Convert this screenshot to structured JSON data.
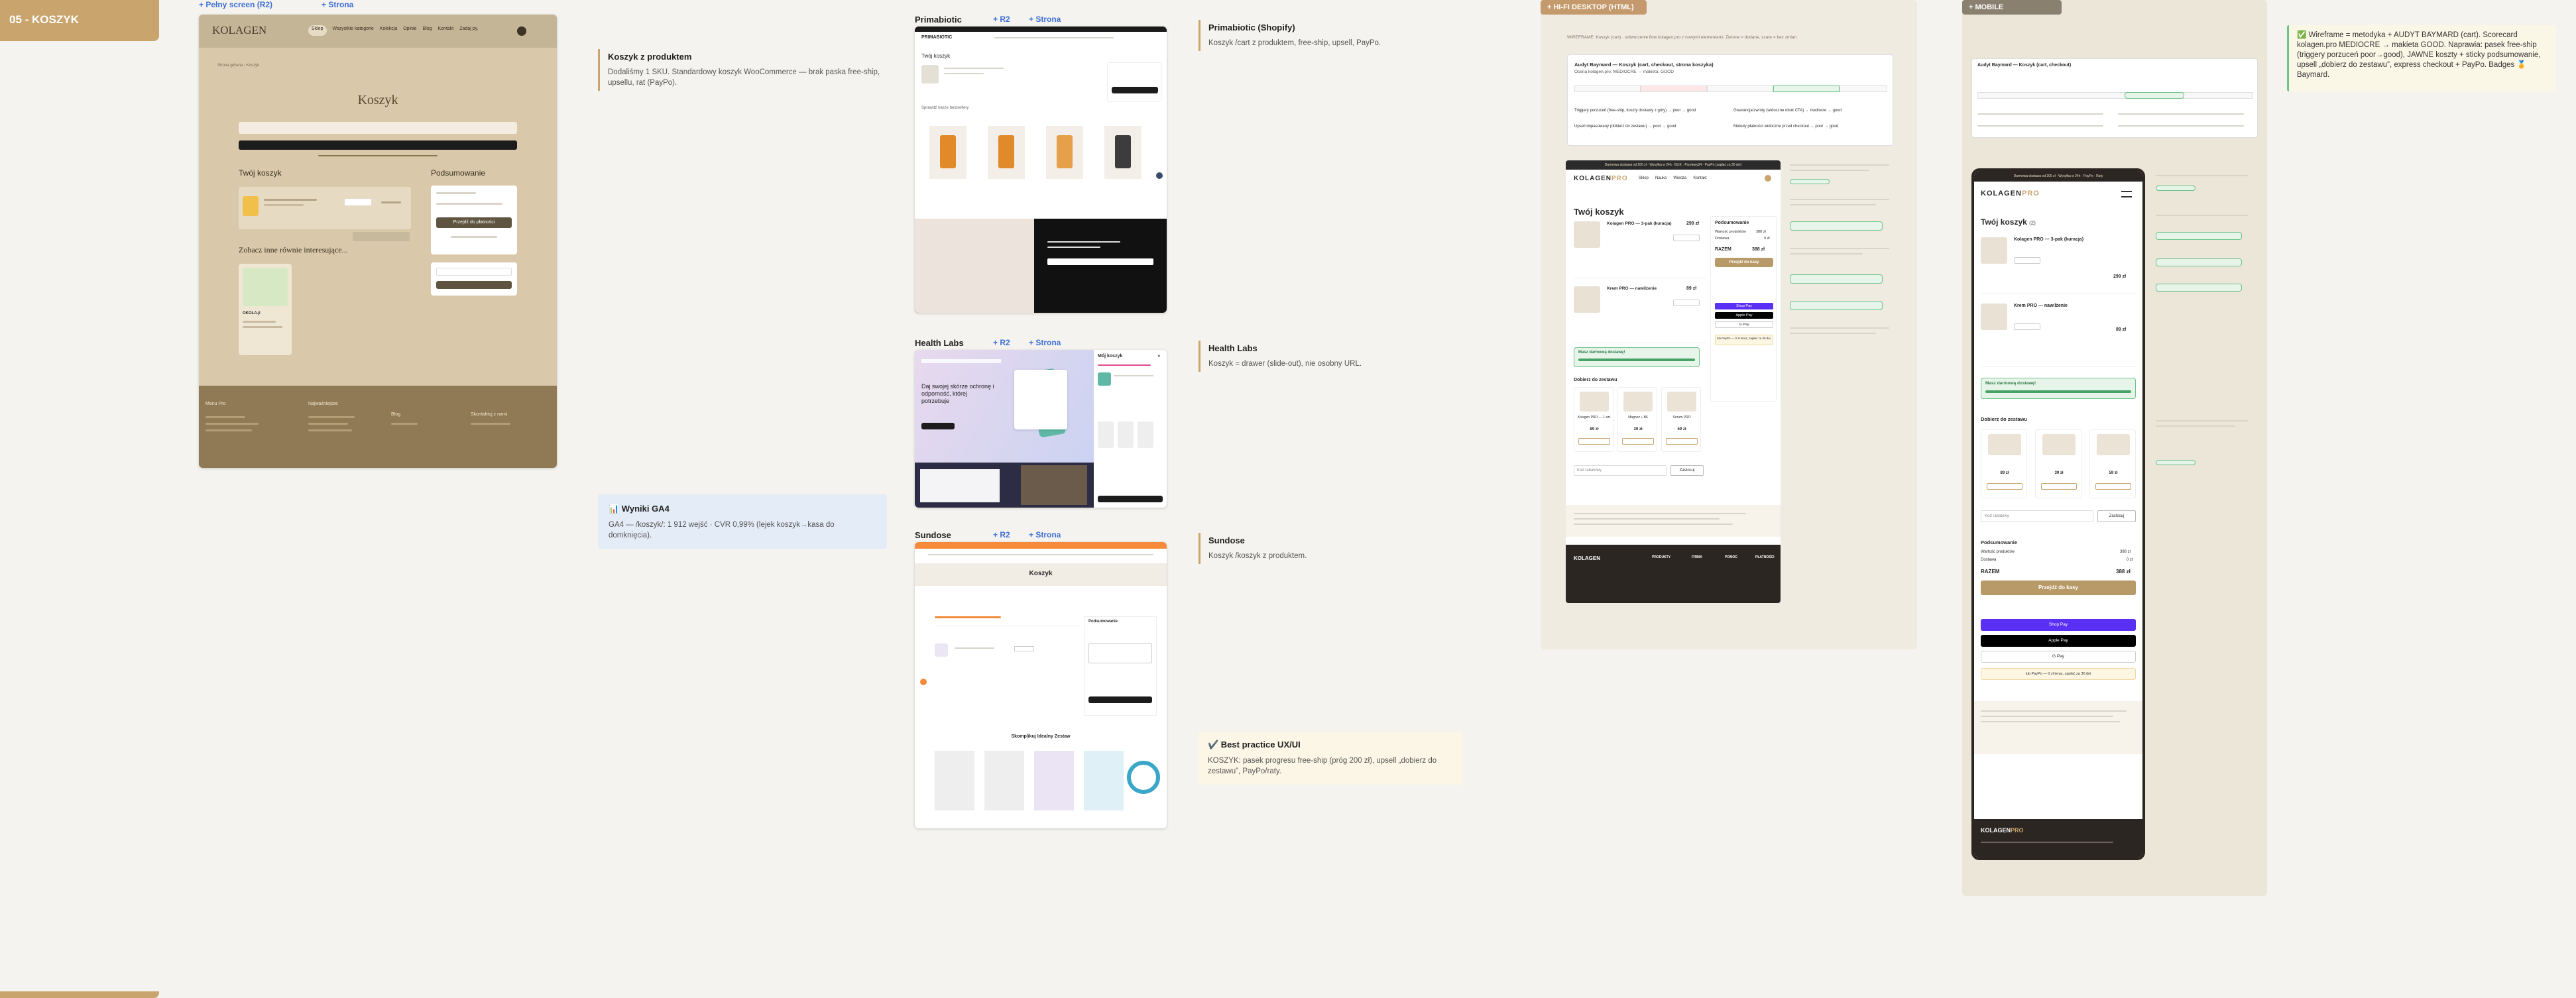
{
  "section": {
    "label": "05 - KOSZYK"
  },
  "kolagen_desktop": {
    "full_link": "+ Pełny screen (R2)",
    "page_link": "+ Strona",
    "logo": "KOLAGEN",
    "nav": [
      "Sklep",
      "Wszystkie kategorie",
      "Kolekcja",
      "Opinie",
      "Blog",
      "Kontakt",
      "Zadaj py."
    ],
    "breadcrumb": "Strona główna › Koszyk",
    "page_title": "Koszyk",
    "your_cart": "Twój koszyk",
    "summary": "Podsumowanie",
    "checkout_btn": "Przejdź do płatności",
    "related": "Zobacz inne równie interesujące...",
    "product_name": "OKOLA.jl",
    "footer_cols": [
      "Menu Pro",
      "Najważniejsze",
      "Blog",
      "Skontaktuj z nami"
    ]
  },
  "kolagen_note": {
    "title": "Koszyk z produktem",
    "body": "Dodaliśmy 1 SKU. Standardowy koszyk WooCommerce — brak paska free-ship, upsellu, rat (PayPo)."
  },
  "ga4_note": {
    "title": "📊 Wyniki GA4",
    "body": "GA4 — /koszyk/: 1 912 wejść · CVR 0,99% (lejek koszyk→kasa do domknięcia)."
  },
  "primabiotic": {
    "name": "Primabiotic",
    "r2": "+ R2",
    "page": "+ Strona",
    "note_title": "Primabiotic (Shopify)",
    "note_body": "Koszyk /cart z produktem, free-ship, upsell, PayPo.",
    "logo": "PRIMABIOTIC",
    "cart_label": "Twój koszyk",
    "upsell": "Sprawdź nasze bestsellery"
  },
  "healthlabs": {
    "name": "Health Labs",
    "r2": "+ R2",
    "page": "+ Strona",
    "note_title": "Health Labs",
    "note_body": "Koszyk = drawer (slide-out), nie osobny URL.",
    "headline": "Daj swojej skórze ochronę i odporność, której potrzebuje",
    "drawer_title": "Mój koszyk"
  },
  "sundose": {
    "name": "Sundose",
    "r2": "+ R2",
    "page": "+ Strona",
    "note_title": "Sundose",
    "note_body": "Koszyk /koszyk z produktem.",
    "page_title": "Koszyk",
    "summary": "Podsumowanie",
    "bestsellers": "Skomplikuj Idealny Zestaw"
  },
  "best_practice": {
    "title": "✔️ Best practice UX/UI",
    "body": "KOSZYK: pasek progresu free-ship (próg 200 zł), upsell „dobierz do zestawu”, PayPo/raty."
  },
  "hifi_desktop": {
    "tag": "+ HI-FI DESKTOP (HTML)",
    "intro": "WIREFRAME: Koszyk (cart) · odtworzenie flow kolagen.pro z nowymi elementami. Zielone = dodane, szare = bez zmian.",
    "audit_title": "Audyt Baymard — Koszyk (cart, checkout, strona koszyka)",
    "audit_sub": "Ocena kolagen.pro: MEDIOCRE → makieta: GOOD",
    "audit_items": [
      "Triggery porzuceń (free-ship, koszty dostawy z góry) → poor → good",
      "Gwarancja/zwroty (widoczne obok CTA) → mediocre → good",
      "Upsell dopasowany (dobierz do zestawu) → poor → good",
      "Metody płatności widoczne przed checkout → poor → good"
    ],
    "promo_bar": "Darmowa dostawa od 200 zł · Wysyłka w 24h · BLIK · Przelewy24 · PayPo (zapłać za 30 dni)",
    "logo": "KOLAGEN",
    "logo_accent": "PRO",
    "nav": [
      "Sklep",
      "Nauka",
      "Wiedza",
      "Kontakt"
    ],
    "cart_title": "Twój koszyk",
    "item1_name": "Kolagen PRO — 3-pak (kuracja)",
    "item1_price": "299 zł",
    "item2_name": "Krem PRO — nawilżenie",
    "item2_price": "89 zł",
    "summary_title": "Podsumowanie",
    "subtotal_label": "Wartość produktów",
    "subtotal_val": "388 zł",
    "shipping_label": "Dostawa",
    "shipping_val": "0 zł",
    "total_label": "RAZEM",
    "total_val": "388 zł",
    "checkout_btn": "Przejdź do kasy",
    "shop_pay": "Shop Pay",
    "apple_pay": "Apple Pay",
    "gpay": "G Pay",
    "paypo": "lub PayPo — 0 zł teraz, zapłać za 30 dni",
    "freeship_label": "Masz darmową dostawę!",
    "freeship_progress": 1.0,
    "upsell_title": "Dobierz do zestawu",
    "upsell_items": [
      {
        "name": "Kolagen PRO — 1 szt.",
        "price": "89 zł"
      },
      {
        "name": "Magnez + B6",
        "price": "39 zł"
      },
      {
        "name": "Serum PRO",
        "price": "59 zł"
      }
    ],
    "coupon_placeholder": "Kod rabatowy",
    "coupon_btn": "Zastosuj",
    "footer_logo": "KOLAGEN",
    "footer_cols": [
      "PRODUKTY",
      "FIRMA",
      "POMOC",
      "PŁATNOŚCI"
    ]
  },
  "mobile": {
    "tag": "+ MOBILE",
    "audit_title": "Audyt Baymard — Koszyk (cart, checkout)",
    "promo_bar": "Darmowa dostawa od 200 zł · Wysyłka w 24h · PayPo · Raty",
    "logo": "KOLAGEN",
    "logo_accent": "PRO",
    "cart_title": "Twój koszyk",
    "cart_count": "(2)",
    "item1_name": "Kolagen PRO — 3-pak (kuracja)",
    "item1_price": "299 zł",
    "item2_name": "Krem PRO — nawilżenie",
    "item2_price": "89 zł",
    "freeship_label": "Masz darmową dostawę!",
    "upsell_title": "Dobierz do zestawu",
    "upsell_prices": [
      "89 zł",
      "39 zł",
      "59 zł"
    ],
    "coupon_placeholder": "Kod rabatowy",
    "coupon_btn": "Zastosuj",
    "summary_title": "Podsumowanie",
    "subtotal_label": "Wartość produktów",
    "subtotal_val": "388 zł",
    "shipping_label": "Dostawa",
    "shipping_val": "0 zł",
    "total_label": "RAZEM",
    "total_val": "388 zł",
    "checkout_btn": "Przejdź do kasy",
    "shop_pay": "Shop Pay",
    "apple_pay": "Apple Pay",
    "gpay": "G Pay",
    "paypo": "lub PayPo — 0 zł teraz, zapłać za 30 dni",
    "footer_logo": "KOLAGEN",
    "footer_accent": "PRO"
  },
  "summary_note": {
    "body": "✅ Wireframe = metodyka + AUDYT BAYMARD (cart). Scorecard kolagen.pro MEDIOCRE → makieta GOOD. Naprawia: pasek free-ship (triggery porzuceń poor→good), JAWNE koszty + sticky podsumowanie, upsell „dobierz do zestawu”, express checkout + PayPo. Badges 🏅 Baymard."
  },
  "colors": {
    "gold": "#c9a46c",
    "dark": "#1c1c1c",
    "green": "#6ec28a",
    "shop_pay": "#5a31f4"
  }
}
